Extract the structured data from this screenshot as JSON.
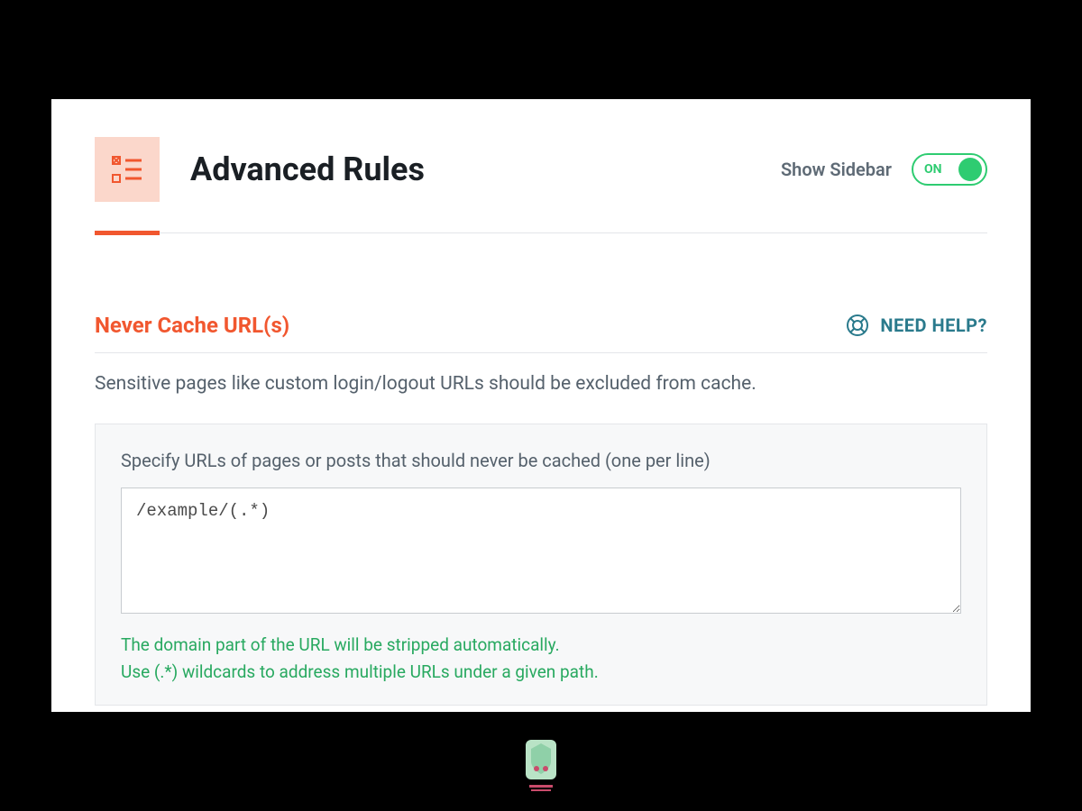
{
  "header": {
    "title": "Advanced Rules",
    "show_sidebar_label": "Show Sidebar",
    "toggle_state": "ON"
  },
  "section": {
    "title": "Never Cache URL(s)",
    "help_label": "NEED HELP?",
    "description": "Sensitive pages like custom login/logout URLs should be excluded from cache.",
    "field_label": "Specify URLs of pages or posts that should never be cached (one per line)",
    "textarea_value": "/example/(.*)",
    "hint_line1": "The domain part of the URL will be stripped automatically.",
    "hint_line2": "Use (.*) wildcards to address multiple URLs under a given path."
  }
}
